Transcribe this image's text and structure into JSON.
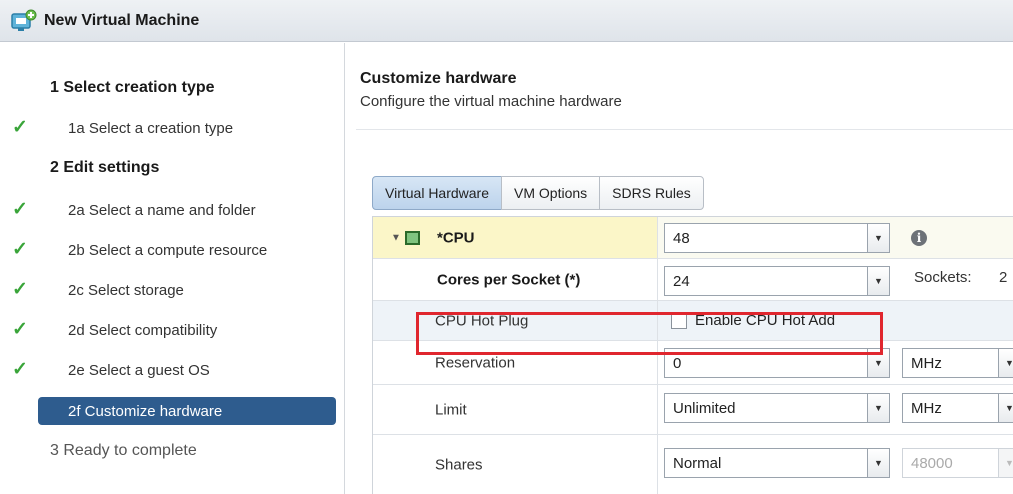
{
  "window": {
    "title": "New Virtual Machine"
  },
  "nav": {
    "steps": [
      {
        "label": "1  Select creation type",
        "kind": "header",
        "checked": false
      },
      {
        "label": "1a  Select a creation type",
        "kind": "sub",
        "checked": true
      },
      {
        "label": "2  Edit settings",
        "kind": "header",
        "checked": false
      },
      {
        "label": "2a  Select a name and folder",
        "kind": "sub",
        "checked": true
      },
      {
        "label": "2b  Select a compute resource",
        "kind": "sub",
        "checked": true
      },
      {
        "label": "2c  Select storage",
        "kind": "sub",
        "checked": true
      },
      {
        "label": "2d  Select compatibility",
        "kind": "sub",
        "checked": true
      },
      {
        "label": "2e  Select a guest OS",
        "kind": "sub",
        "checked": true
      },
      {
        "label": "2f  Customize hardware",
        "kind": "active",
        "checked": false
      },
      {
        "label": "3  Ready to complete",
        "kind": "future",
        "checked": false
      }
    ]
  },
  "main": {
    "heading": "Customize hardware",
    "subheading": "Configure the virtual machine hardware",
    "tabs": [
      {
        "label": "Virtual Hardware",
        "active": true
      },
      {
        "label": "VM Options",
        "active": false
      },
      {
        "label": "SDRS Rules",
        "active": false
      }
    ],
    "cpu": {
      "label": "*CPU",
      "value": "48",
      "cores_label": "Cores per Socket (*)",
      "cores_value": "24",
      "sockets_label": "Sockets:",
      "sockets_value": "2",
      "hotplug_label": "CPU Hot Plug",
      "hotplug_checkbox_label": "Enable CPU Hot Add",
      "hotplug_checked": false,
      "reservation_label": "Reservation",
      "reservation_value": "0",
      "reservation_unit": "MHz",
      "limit_label": "Limit",
      "limit_value": "Unlimited",
      "limit_unit": "MHz",
      "shares_label": "Shares",
      "shares_value": "Normal",
      "shares_amount": "48000"
    }
  },
  "colors": {
    "active_step": "#2e5c8e",
    "check": "#3aa53a",
    "highlight_box": "#e0262e",
    "cpu_row": "#fbf6c8"
  }
}
